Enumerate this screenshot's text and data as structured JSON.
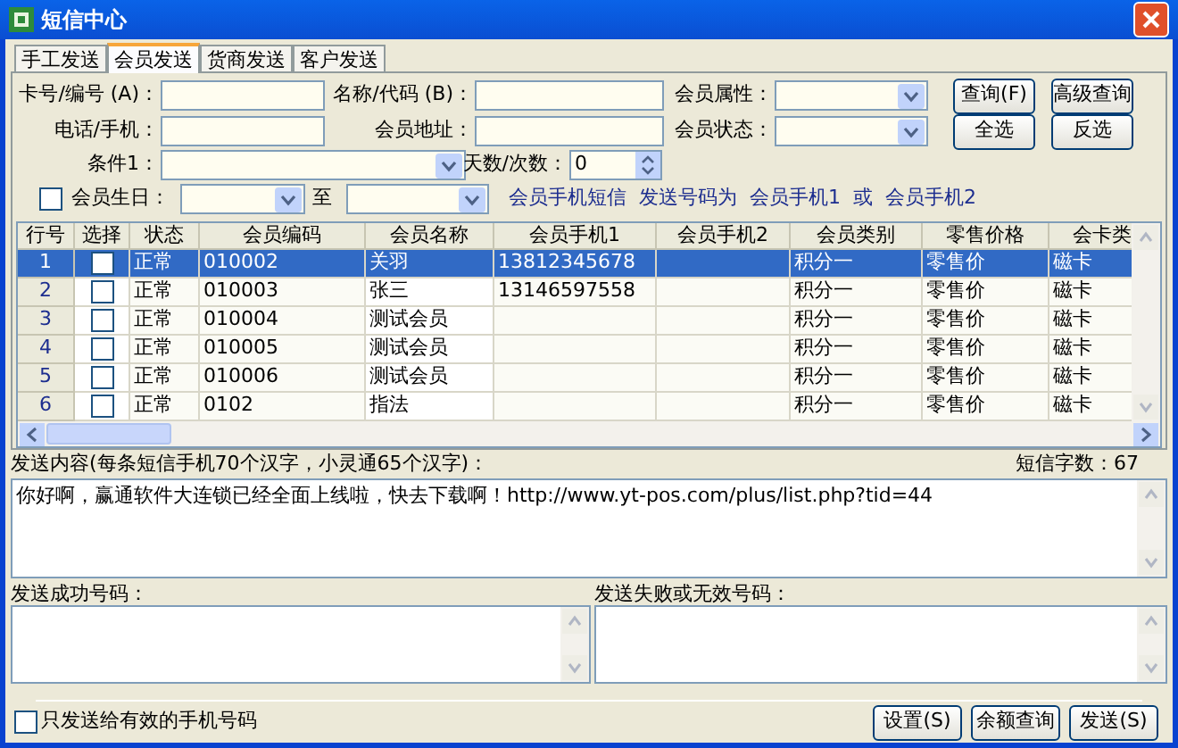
{
  "window": {
    "title": "短信中心"
  },
  "tabs": [
    {
      "label": "手工发送",
      "selected": false
    },
    {
      "label": "会员发送",
      "selected": true
    },
    {
      "label": "货商发送",
      "selected": false
    },
    {
      "label": "客户发送",
      "selected": false
    }
  ],
  "search": {
    "card_no": {
      "label": "卡号/编号 (A)："
    },
    "name_code": {
      "label": "名称/代码 (B)："
    },
    "member_attr": {
      "label": "会员属性："
    },
    "phone": {
      "label": "电话/手机："
    },
    "address": {
      "label": "会员地址："
    },
    "member_state": {
      "label": "会员状态："
    },
    "condition": {
      "label": "条件1："
    },
    "days": {
      "label": "天数/次数：",
      "value": "0"
    },
    "birthday": {
      "label": "会员生日：",
      "checked": false,
      "to": "至"
    },
    "hint": "会员手机短信  发送号码为  会员手机1  或  会员手机2",
    "buttons": [
      "查询(F)",
      "高级查询",
      "全选",
      "反选"
    ]
  },
  "table": {
    "columns": [
      "行号",
      "选择",
      "状态",
      "会员编码",
      "会员名称",
      "会员手机1",
      "会员手机2",
      "会员类别",
      "零售价格",
      "会卡类"
    ],
    "rows": [
      {
        "checked": false,
        "selected": true,
        "cells": [
          "1",
          "",
          "正常",
          "010002",
          "关羽",
          "13812345678",
          "",
          "积分一",
          "零售价",
          "磁卡"
        ]
      },
      {
        "checked": false,
        "selected": false,
        "cells": [
          "2",
          "",
          "正常",
          "010003",
          "张三",
          "13146597558",
          "",
          "积分一",
          "零售价",
          "磁卡"
        ]
      },
      {
        "checked": false,
        "selected": false,
        "cells": [
          "3",
          "",
          "正常",
          "010004",
          "测试会员",
          "",
          "",
          "积分一",
          "零售价",
          "磁卡"
        ]
      },
      {
        "checked": false,
        "selected": false,
        "cells": [
          "4",
          "",
          "正常",
          "010005",
          "测试会员",
          "",
          "",
          "积分一",
          "零售价",
          "磁卡"
        ]
      },
      {
        "checked": false,
        "selected": false,
        "cells": [
          "5",
          "",
          "正常",
          "010006",
          "测试会员",
          "",
          "",
          "积分一",
          "零售价",
          "磁卡"
        ]
      },
      {
        "checked": false,
        "selected": false,
        "cells": [
          "6",
          "",
          "正常",
          "0102",
          "指法",
          "",
          "",
          "积分一",
          "零售价",
          "磁卡"
        ]
      }
    ]
  },
  "message": {
    "label": "发送内容(每条短信手机70个汉字，小灵通65个汉字)：",
    "count": "短信字数：67",
    "value": "你好啊，赢通软件大连锁已经全面上线啦，快去下载啊！http://www.yt-pos.com/plus/list.php?tid=44"
  },
  "success": {
    "label": "发送成功号码："
  },
  "failed": {
    "label": "发送失败或无效号码："
  },
  "valid_only": {
    "label": "只发送给有效的手机号码",
    "checked": false
  },
  "actions": [
    "设置(S)",
    "余额查询",
    "发送(S)"
  ]
}
